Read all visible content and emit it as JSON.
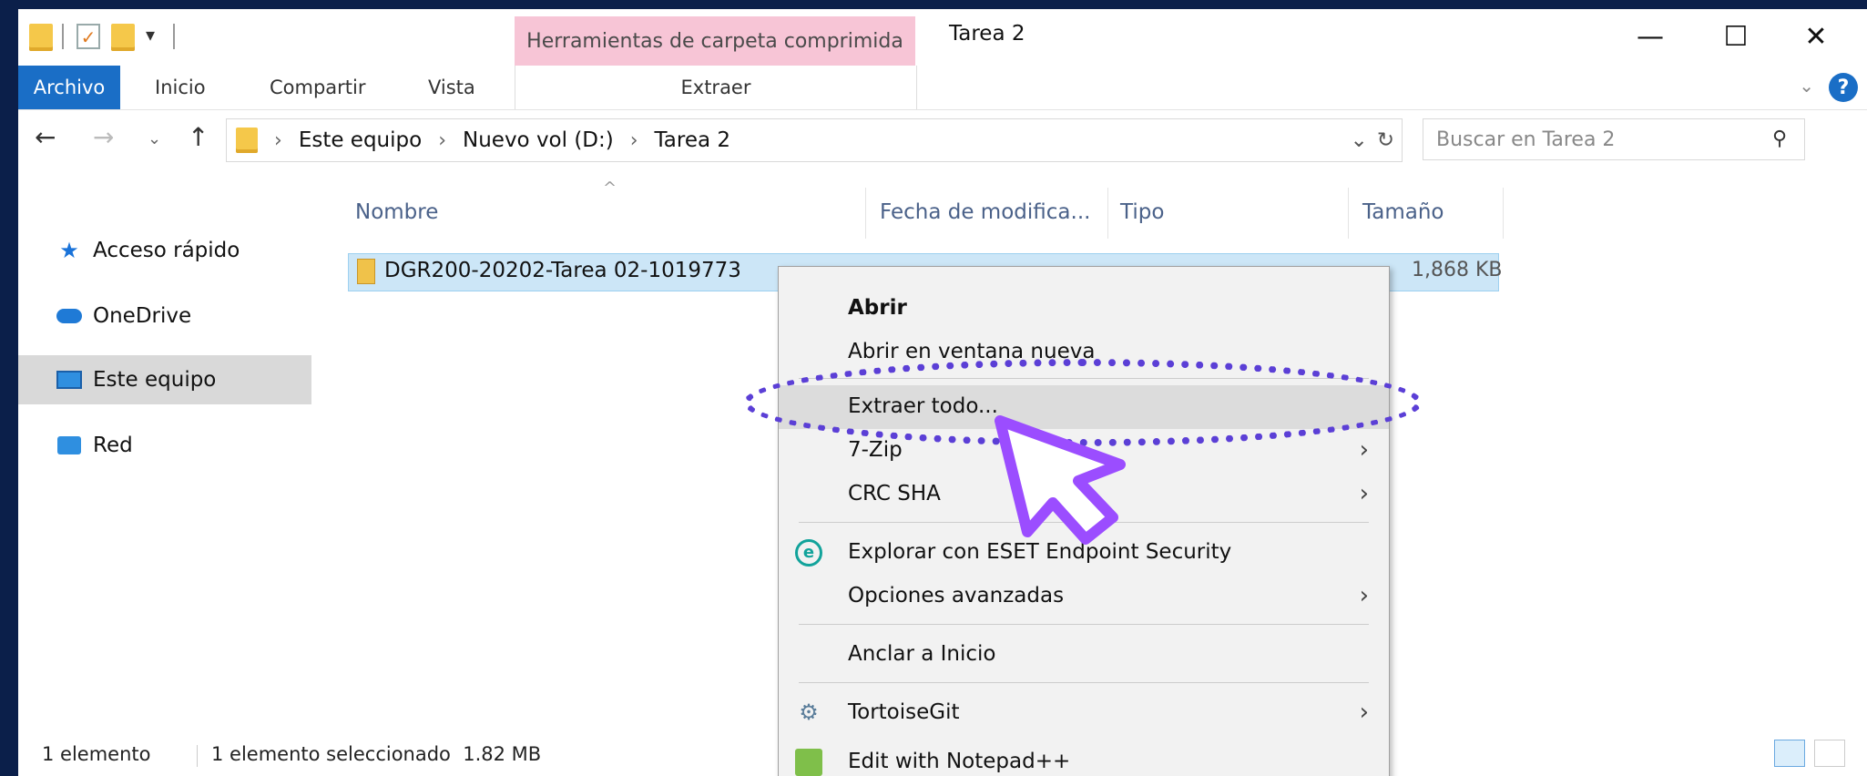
{
  "window": {
    "contextual_tab_group": "Herramientas de carpeta comprimida",
    "title": "Tarea 2",
    "controls": {
      "minimize": "—",
      "maximize": "☐",
      "close": "✕"
    }
  },
  "ribbon": {
    "tabs": [
      "Archivo",
      "Inicio",
      "Compartir",
      "Vista"
    ],
    "contextual_tab": "Extraer",
    "help": "?"
  },
  "address": {
    "crumbs": [
      "Este equipo",
      "Nuevo vol (D:)",
      "Tarea 2"
    ],
    "search_placeholder": "Buscar en Tarea 2"
  },
  "sidebar": {
    "items": [
      {
        "label": "Acceso rápido",
        "icon": "star-icon"
      },
      {
        "label": "OneDrive",
        "icon": "cloud-icon"
      },
      {
        "label": "Este equipo",
        "icon": "computer-icon",
        "selected": true
      },
      {
        "label": "Red",
        "icon": "network-icon"
      }
    ]
  },
  "filelist": {
    "columns": [
      "Nombre",
      "Fecha de modifica...",
      "Tipo",
      "Tamaño"
    ],
    "rows": [
      {
        "name": "DGR200-20202-Tarea 02-1019773",
        "size": "1,868 KB"
      }
    ]
  },
  "status": {
    "count": "1 elemento",
    "selected": "1 elemento seleccionado  1.82 MB"
  },
  "context_menu": {
    "items": {
      "abrir": "Abrir",
      "abrir_nueva": "Abrir en ventana nueva",
      "extraer": "Extraer todo...",
      "zip": "7-Zip",
      "crc": "CRC SHA",
      "eset": "Explorar con ESET Endpoint Security",
      "opciones": "Opciones avanzadas",
      "anclar": "Anclar a Inicio",
      "tortoise": "TortoiseGit",
      "notepad": "Edit with Notepad++"
    }
  },
  "colors": {
    "accent": "#1a6ec6",
    "contextual_tab": "#f7c5d6",
    "selection": "#cce6f7",
    "highlight_ellipse": "#5b3fd6",
    "cursor": "#9b4dff",
    "background": "#0b1f4a"
  }
}
